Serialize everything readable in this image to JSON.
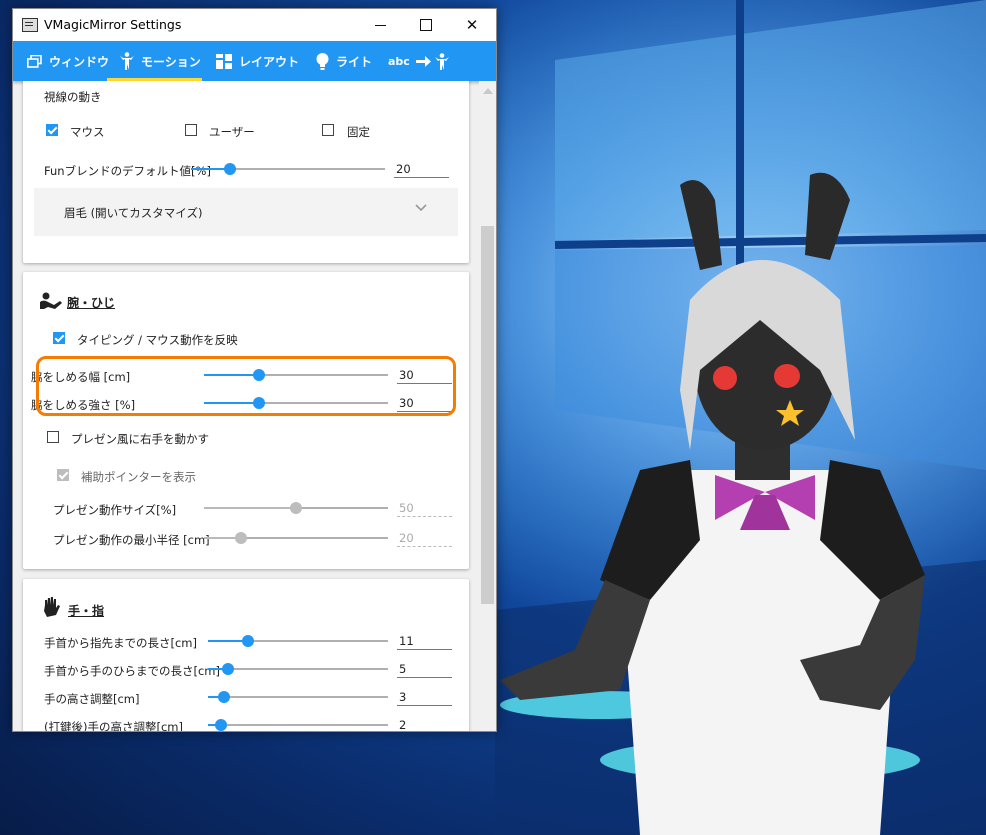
{
  "window": {
    "title": "VMagicMirror Settings",
    "icon": "app-icon",
    "controls": {
      "minimize": "minimize-icon",
      "maximize": "maximize-icon",
      "close": "✕"
    }
  },
  "tabs": [
    {
      "label": "ウィンドウ",
      "icon": "window-icon"
    },
    {
      "label": "モーション",
      "icon": "person-icon",
      "selected": true
    },
    {
      "label": "レイアウト",
      "icon": "grid-icon"
    },
    {
      "label": "ライト",
      "icon": "bulb-icon"
    },
    {
      "label": "abc",
      "icon": "word-to-motion-icon"
    }
  ],
  "colors": {
    "accent": "#2196f3",
    "tab_underline": "#fdd835",
    "highlight": "#f57c00"
  },
  "eye_section": {
    "heading": "視線の動き",
    "options": [
      {
        "label": "マウス",
        "checked": true
      },
      {
        "label": "ユーザー",
        "checked": false
      },
      {
        "label": "固定",
        "checked": false
      }
    ],
    "fun_blend": {
      "label": "Funブレンドのデフォルト値[%]",
      "value": "20",
      "fraction": 0.2
    },
    "eyebrow_expander": {
      "label": "眉毛 (開いてカスタマイズ)"
    }
  },
  "arm_section": {
    "title": "腕・ひじ",
    "icon": "arm-icon",
    "typing_reflect": {
      "label": "タイピング / マウス動作を反映",
      "checked": true
    },
    "waist_width": {
      "label": "脇をしめる幅 [cm]",
      "value": "30",
      "fraction": 0.3
    },
    "waist_strength": {
      "label": "脇をしめる強さ [%]",
      "value": "30",
      "fraction": 0.3
    },
    "presentation": {
      "label": "プレゼン風に右手を動かす",
      "checked": false
    },
    "show_pointer": {
      "label": "補助ポインターを表示",
      "checked": true,
      "disabled": true
    },
    "present_size": {
      "label": "プレゼン動作サイズ[%]",
      "value": "50",
      "fraction": 0.5
    },
    "present_radius": {
      "label": "プレゼン動作の最小半径 [cm]",
      "value": "20",
      "fraction": 0.2
    }
  },
  "hand_section": {
    "title": "手・指",
    "icon": "hand-icon",
    "wrist_to_tip": {
      "label": "手首から指先までの長さ[cm]",
      "value": "11",
      "fraction": 0.22
    },
    "wrist_to_palm": {
      "label": "手首から手のひらまでの長さ[cm]",
      "value": "5",
      "fraction": 0.11
    },
    "hand_height": {
      "label": "手の高さ調整[cm]",
      "value": "3",
      "fraction": 0.09
    },
    "hand_height_after": {
      "label": "(打鍵後)手の高さ調整[cm]",
      "value": "2",
      "fraction": 0.07
    }
  }
}
